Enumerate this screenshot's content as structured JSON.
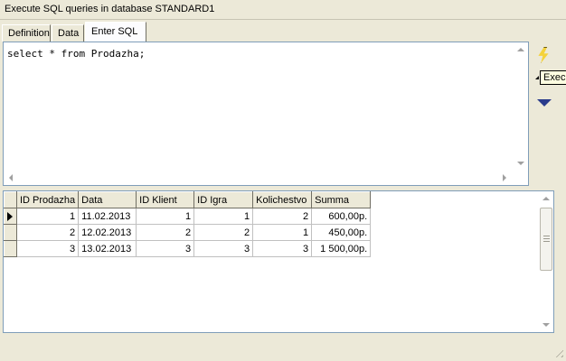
{
  "window": {
    "title": "Execute SQL queries in database STANDARD1"
  },
  "tabs": [
    {
      "label": "Definition",
      "active": false
    },
    {
      "label": "Data",
      "active": false
    },
    {
      "label": "Enter SQL",
      "active": true
    }
  ],
  "editor": {
    "sql": "select * from Prodazha;"
  },
  "toolbar": {
    "execute_icon": "lightning-bolt",
    "execute_tooltip": "Execute",
    "expand_icon": "triangle-down"
  },
  "grid": {
    "columns": [
      "ID Prodazha",
      "Data",
      "ID Klient",
      "ID Igra",
      "Kolichestvo",
      "Summa"
    ],
    "rows": [
      [
        "1",
        "11.02.2013",
        "1",
        "1",
        "2",
        "600,00р."
      ],
      [
        "2",
        "12.02.2013",
        "2",
        "2",
        "1",
        "450,00р."
      ],
      [
        "3",
        "13.02.2013",
        "3",
        "3",
        "3",
        "1 500,00р."
      ]
    ],
    "current_row": 0
  },
  "colors": {
    "face": "#ece9d8",
    "border": "#7f9db9",
    "tooltip": "#ffffe1",
    "arrow": "#2a3c8c"
  }
}
